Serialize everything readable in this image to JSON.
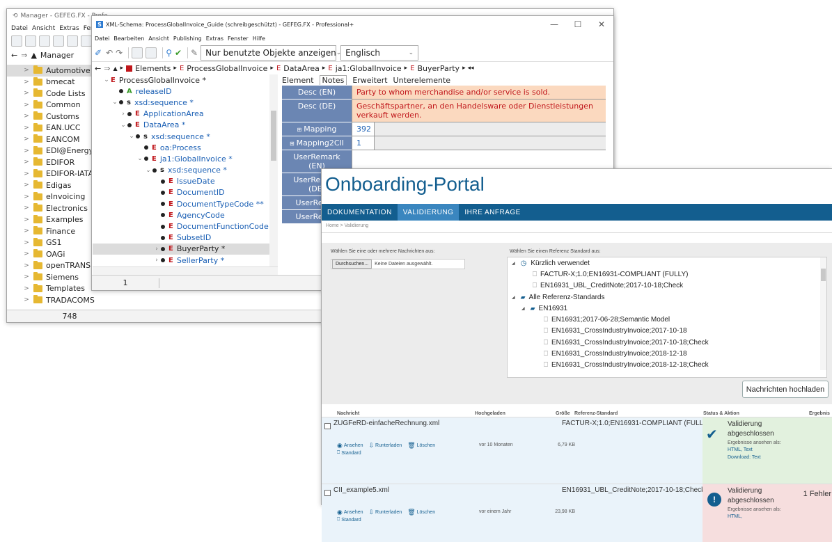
{
  "manager": {
    "title": "Manager - GEFEG.FX - Profe",
    "menu": [
      "Datei",
      "Ansicht",
      "Extras",
      "Fens"
    ],
    "nav_label": "Manager",
    "folders": [
      "Automotive",
      "bmecat",
      "Code Lists",
      "Common",
      "Customs",
      "EAN.UCC",
      "EANCOM",
      "EDI@Energy",
      "EDIFOR",
      "EDIFOR-IATA",
      "Edigas",
      "eInvoicing",
      "Electronics",
      "Examples",
      "Finance",
      "GS1",
      "OAGi",
      "openTRANS",
      "Siemens",
      "Templates",
      "TRADACOMS"
    ],
    "status_count": "748"
  },
  "xml": {
    "title": "XML-Schema: ProcessGlobalInvoice_Guide (schreibgeschützt) - GEFEG.FX - Professional+",
    "app_letter": "S",
    "menu": [
      "Datei",
      "Bearbeiten",
      "Ansicht",
      "Publishing",
      "Extras",
      "Fenster",
      "Hilfe"
    ],
    "filter_combo": "Nur benutzte Objekte anzeigen",
    "lang_combo": "Englisch",
    "breadcrumb": [
      "Elements",
      "ProcessGlobalInvoice",
      "DataArea",
      "ja1:GlobalInvoice",
      "BuyerParty"
    ],
    "tree": [
      {
        "indent": 0,
        "chev": "v",
        "kind": "E",
        "label": "ProcessGlobalInvoice *",
        "dot": false,
        "color": "dark"
      },
      {
        "indent": 1,
        "chev": "",
        "kind": "A",
        "label": "releaseID",
        "dot": true,
        "color": "blue"
      },
      {
        "indent": 1,
        "chev": "v",
        "kind": "s",
        "label": "xsd:sequence *",
        "dot": true,
        "color": "blue"
      },
      {
        "indent": 2,
        "chev": ">",
        "kind": "E",
        "label": "ApplicationArea",
        "dot": true,
        "color": "blue"
      },
      {
        "indent": 2,
        "chev": "v",
        "kind": "E",
        "label": "DataArea *",
        "dot": true,
        "color": "blue"
      },
      {
        "indent": 3,
        "chev": "v",
        "kind": "s",
        "label": "xsd:sequence *",
        "dot": true,
        "color": "blue"
      },
      {
        "indent": 4,
        "chev": "",
        "kind": "E",
        "label": "oa:Process",
        "dot": true,
        "color": "blue"
      },
      {
        "indent": 4,
        "chev": "v",
        "kind": "E",
        "label": "ja1:GlobalInvoice *",
        "dot": true,
        "color": "blue"
      },
      {
        "indent": 5,
        "chev": "v",
        "kind": "s",
        "label": "xsd:sequence *",
        "dot": true,
        "color": "blue"
      },
      {
        "indent": 6,
        "chev": "",
        "kind": "E",
        "label": "IssueDate",
        "dot": true,
        "color": "blue"
      },
      {
        "indent": 6,
        "chev": "",
        "kind": "E",
        "label": "DocumentID",
        "dot": true,
        "color": "blue"
      },
      {
        "indent": 6,
        "chev": "",
        "kind": "E",
        "label": "DocumentTypeCode **",
        "dot": true,
        "color": "blue"
      },
      {
        "indent": 6,
        "chev": "",
        "kind": "E",
        "label": "AgencyCode",
        "dot": true,
        "color": "blue"
      },
      {
        "indent": 6,
        "chev": "",
        "kind": "E",
        "label": "DocumentFunctionCode *",
        "dot": true,
        "color": "blue"
      },
      {
        "indent": 6,
        "chev": "",
        "kind": "E",
        "label": "SubsetID",
        "dot": true,
        "color": "blue"
      },
      {
        "indent": 6,
        "chev": ">",
        "kind": "E",
        "label": "BuyerParty *",
        "dot": true,
        "color": "dark",
        "selected": true
      },
      {
        "indent": 6,
        "chev": ">",
        "kind": "E",
        "label": "SellerParty *",
        "dot": true,
        "color": "blue"
      }
    ],
    "tabs": [
      "Element",
      "Notes",
      "Erweitert",
      "Unterelemente"
    ],
    "props": [
      {
        "label": "Desc (EN)",
        "value": "Party to whom merchandise and/or service is sold.",
        "hl": true
      },
      {
        "label": "Desc (DE)",
        "value": "Geschäftspartner, an den Handelsware oder Dienstleistungen verkauft werden.",
        "hl": true
      },
      {
        "label": "Mapping",
        "value": "392",
        "hl": false
      },
      {
        "label": "Mapping2CII",
        "value": "1",
        "hl": false
      },
      {
        "label": "UserRemark (EN)",
        "value": "",
        "hl": false
      },
      {
        "label": "UserRemark (DE)",
        "value": "",
        "hl": false
      },
      {
        "label": "UserRemar",
        "value": "",
        "hl": false
      },
      {
        "label": "UserRemar",
        "value": "",
        "hl": false
      }
    ],
    "status_count": "1"
  },
  "portal": {
    "title": "Onboarding-Portal",
    "nav": [
      "DOKUMENTATION",
      "VALIDIERUNG",
      "IHRE ANFRAGE"
    ],
    "breadcrumb": "Home >  Validierung",
    "upload_label": "Wählen Sie eine oder mehrere Nachrichten aus:",
    "browse_button": "Durchsuchen...",
    "no_file": "Keine Dateien ausgewählt.",
    "ref_label": "Wählen Sie einen Referenz Standard aus:",
    "recent_label": "Kürzlich verwendet",
    "recent": [
      "FACTUR-X;1.0;EN16931-COMPLIANT (FULLY)",
      "EN16931_UBL_CreditNote;2017-10-18;Check"
    ],
    "all_label": "Alle Referenz-Standards",
    "group": "EN16931",
    "standards": [
      "EN16931;2017-06-28;Semantic Model",
      "EN16931_CrossIndustryInvoice;2017-10-18",
      "EN16931_CrossIndustryInvoice;2017-10-18;Check",
      "EN16931_CrossIndustryInvoice;2018-12-18",
      "EN16931_CrossIndustryInvoice;2018-12-18;Check"
    ],
    "upload_button": "Nachrichten hochladen",
    "headers": {
      "message": "Nachricht",
      "uploaded": "Hochgeladen",
      "size": "Größe",
      "ref": "Referenz-Standard",
      "status": "Status & Aktion",
      "result": "Ergebnis"
    },
    "actions": {
      "view": "Ansehen",
      "download": "Runterladen",
      "delete": "Löschen",
      "standard": "Standard"
    },
    "rows": [
      {
        "file": "ZUGFeRD-einfacheRechnung.xml",
        "uploaded": "vor 10 Monaten",
        "size": "6,79 KB",
        "ref": "FACTUR-X;1.0;EN16931-COMPLIANT (FULLY)",
        "status": "Validierung abgeschlossen",
        "sub": "Ergebnisse ansehen als:",
        "links": "HTML, Text",
        "dl": "Download: Text",
        "result": "",
        "ok": true
      },
      {
        "file": "CII_example5.xml",
        "uploaded": "vor einem Jahr",
        "size": "23,98 KB",
        "ref": "EN16931_UBL_CreditNote;2017-10-18;Check",
        "status": "Validierung abgeschlossen",
        "sub": "Ergebnisse ansehen als:",
        "links": "HTML,",
        "dl": "",
        "result": "1 Fehler",
        "ok": false
      }
    ]
  }
}
